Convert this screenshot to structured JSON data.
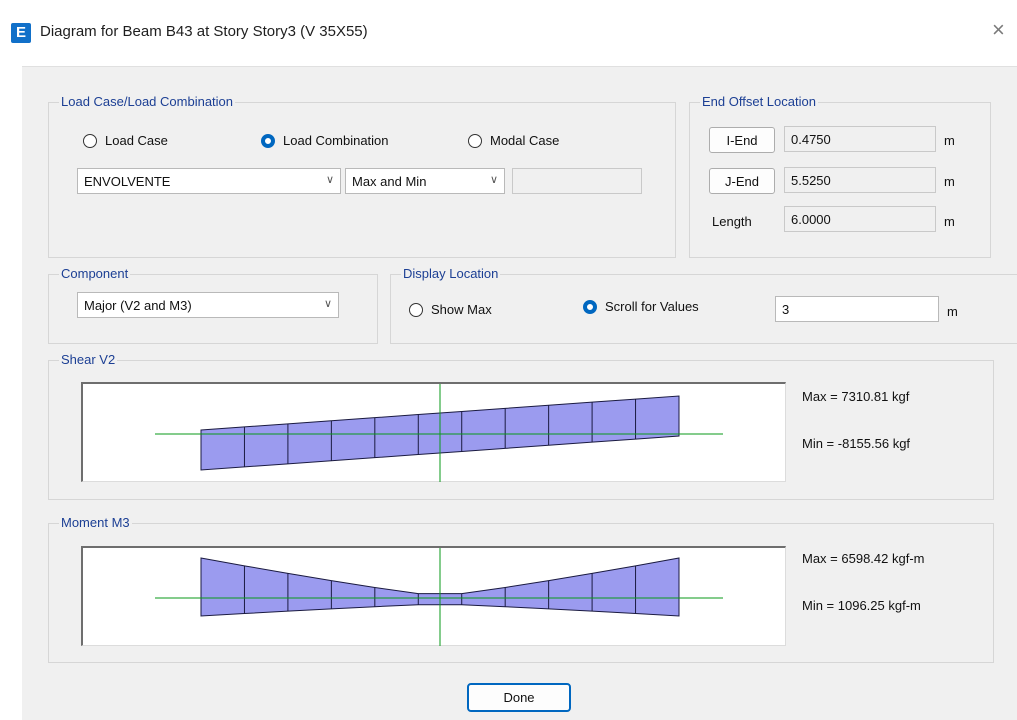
{
  "window": {
    "title": "Diagram for Beam B43 at Story Story3 (V 35X55)",
    "app_icon_letter": "E",
    "close_glyph": "×"
  },
  "load_case_group": {
    "title": "Load Case/Load Combination",
    "options": [
      "Load Case",
      "Load Combination",
      "Modal Case"
    ],
    "selected_index": 1,
    "combo_value": "ENVOLVENTE",
    "type_value": "Max and Min",
    "extra_value": ""
  },
  "end_offset": {
    "title": "End Offset Location",
    "i_end_label": "I-End",
    "i_end_value": "0.4750",
    "j_end_label": "J-End",
    "j_end_value": "5.5250",
    "length_label": "Length",
    "length_value": "6.0000",
    "unit": "m"
  },
  "component": {
    "title": "Component",
    "value": "Major (V2 and M3)"
  },
  "display_location": {
    "title": "Display Location",
    "options": [
      "Show Max",
      "Scroll for Values"
    ],
    "selected_index": 1,
    "value": "3",
    "unit": "m"
  },
  "shear": {
    "title": "Shear V2",
    "max_label": "Max = 7310.81 kgf",
    "min_label": "Min = -8155.56 kgf",
    "max": 7310.81,
    "min": -8155.56
  },
  "moment": {
    "title": "Moment M3",
    "max_label": "Max = 6598.42 kgf-m",
    "min_label": "Min = 1096.25 kgf-m",
    "max": 6598.42,
    "min": 1096.25
  },
  "colors": {
    "fill": "#9b9bef",
    "axis": "#0a9a1a",
    "outline": "#1a1a40",
    "accent": "#0067c0",
    "group_title": "#1c3f94"
  },
  "done_label": "Done"
}
